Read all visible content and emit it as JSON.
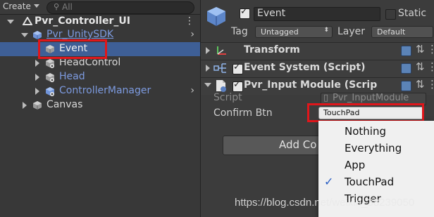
{
  "hierarchy": {
    "create_label": "Create",
    "search_placeholder": "All",
    "scene": "Pvr_Controller_UI",
    "rows": [
      {
        "label": "Pvr_UnitySDK"
      },
      {
        "label": "Event"
      },
      {
        "label": "HeadControl"
      },
      {
        "label": "Head"
      },
      {
        "label": "ControllerManager"
      },
      {
        "label": "Canvas"
      }
    ]
  },
  "inspector": {
    "object_name": "Event",
    "static_label": "Static",
    "tag_label": "Tag",
    "tag_value": "Untagged",
    "layer_label": "Layer",
    "layer_value": "Default",
    "components": [
      {
        "title": "Transform"
      },
      {
        "title": "Event System (Script)"
      },
      {
        "title": "Pvr_Input Module (Scrip"
      }
    ],
    "script_label": "Script",
    "script_value": "Pvr_InputModule",
    "confirm_label": "Confirm Btn",
    "confirm_value": "TouchPad",
    "add_component_label": "Add Co"
  },
  "dropdown": {
    "items": [
      {
        "label": "Nothing",
        "checked": false
      },
      {
        "label": "Everything",
        "checked": false
      },
      {
        "label": "App",
        "checked": false
      },
      {
        "label": "TouchPad",
        "checked": true
      },
      {
        "label": "Trigger",
        "checked": false
      }
    ],
    "check_glyph": "✓"
  },
  "watermark": "https://blog.csdn.net/weixin_38239050",
  "colors": {
    "selection": "#3e5f96",
    "prefab_blue": "#7d9be0",
    "highlight_red": "#e0161b"
  }
}
